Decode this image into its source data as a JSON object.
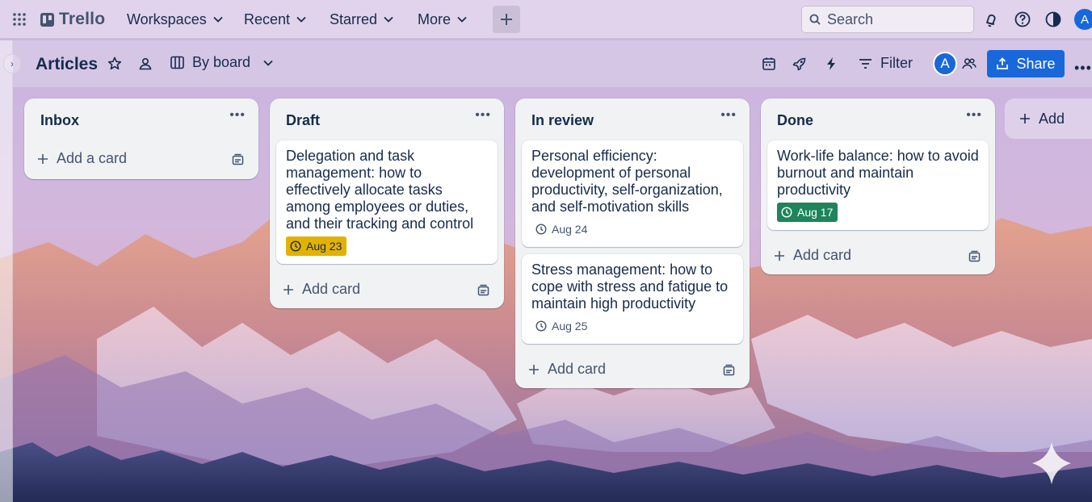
{
  "topnav": {
    "logo_text": "Trello",
    "menus": [
      "Workspaces",
      "Recent",
      "Starred",
      "More"
    ],
    "search_placeholder": "Search",
    "avatar_initial": "A"
  },
  "board": {
    "title": "Articles",
    "view_label": "By board",
    "filter_label": "Filter",
    "member_initial": "A",
    "share_label": "Share"
  },
  "lists": [
    {
      "title": "Inbox",
      "add_label": "Add a card",
      "cards": []
    },
    {
      "title": "Draft",
      "add_label": "Add card",
      "cards": [
        {
          "title": "Delegation and task management: how to effectively allocate tasks among employees or duties, and their tracking and control",
          "due": "Aug 23",
          "due_style": "yellow"
        }
      ]
    },
    {
      "title": "In review",
      "add_label": "Add card",
      "cards": [
        {
          "title": "Personal efficiency: development of personal productivity, self-organization, and self-motivation skills",
          "due": "Aug 24",
          "due_style": "plain"
        },
        {
          "title": "Stress management: how to cope with stress and fatigue to maintain high productivity",
          "due": "Aug 25",
          "due_style": "plain"
        }
      ]
    },
    {
      "title": "Done",
      "add_label": "Add card",
      "cards": [
        {
          "title": "Work-life balance: how to avoid burnout and maintain productivity",
          "due": "Aug 17",
          "due_style": "green"
        }
      ]
    }
  ],
  "add_list_label": "Add",
  "icons": [
    "apps-grid-icon",
    "chevron-down-icon",
    "plus-icon",
    "search-icon",
    "bell-icon",
    "help-icon",
    "theme-icon",
    "star-icon",
    "workspace-visibility-icon",
    "board-view-icon",
    "calendar-icon",
    "power-ups-icon",
    "automation-icon",
    "filter-icon",
    "members-icon",
    "share-icon",
    "list-menu-icon",
    "clock-icon",
    "card-template-icon"
  ],
  "colors": {
    "accent": "#1868db",
    "due_yellow": "#e2b203",
    "due_green": "#1f845a",
    "list_bg": "#f1f2f4"
  }
}
